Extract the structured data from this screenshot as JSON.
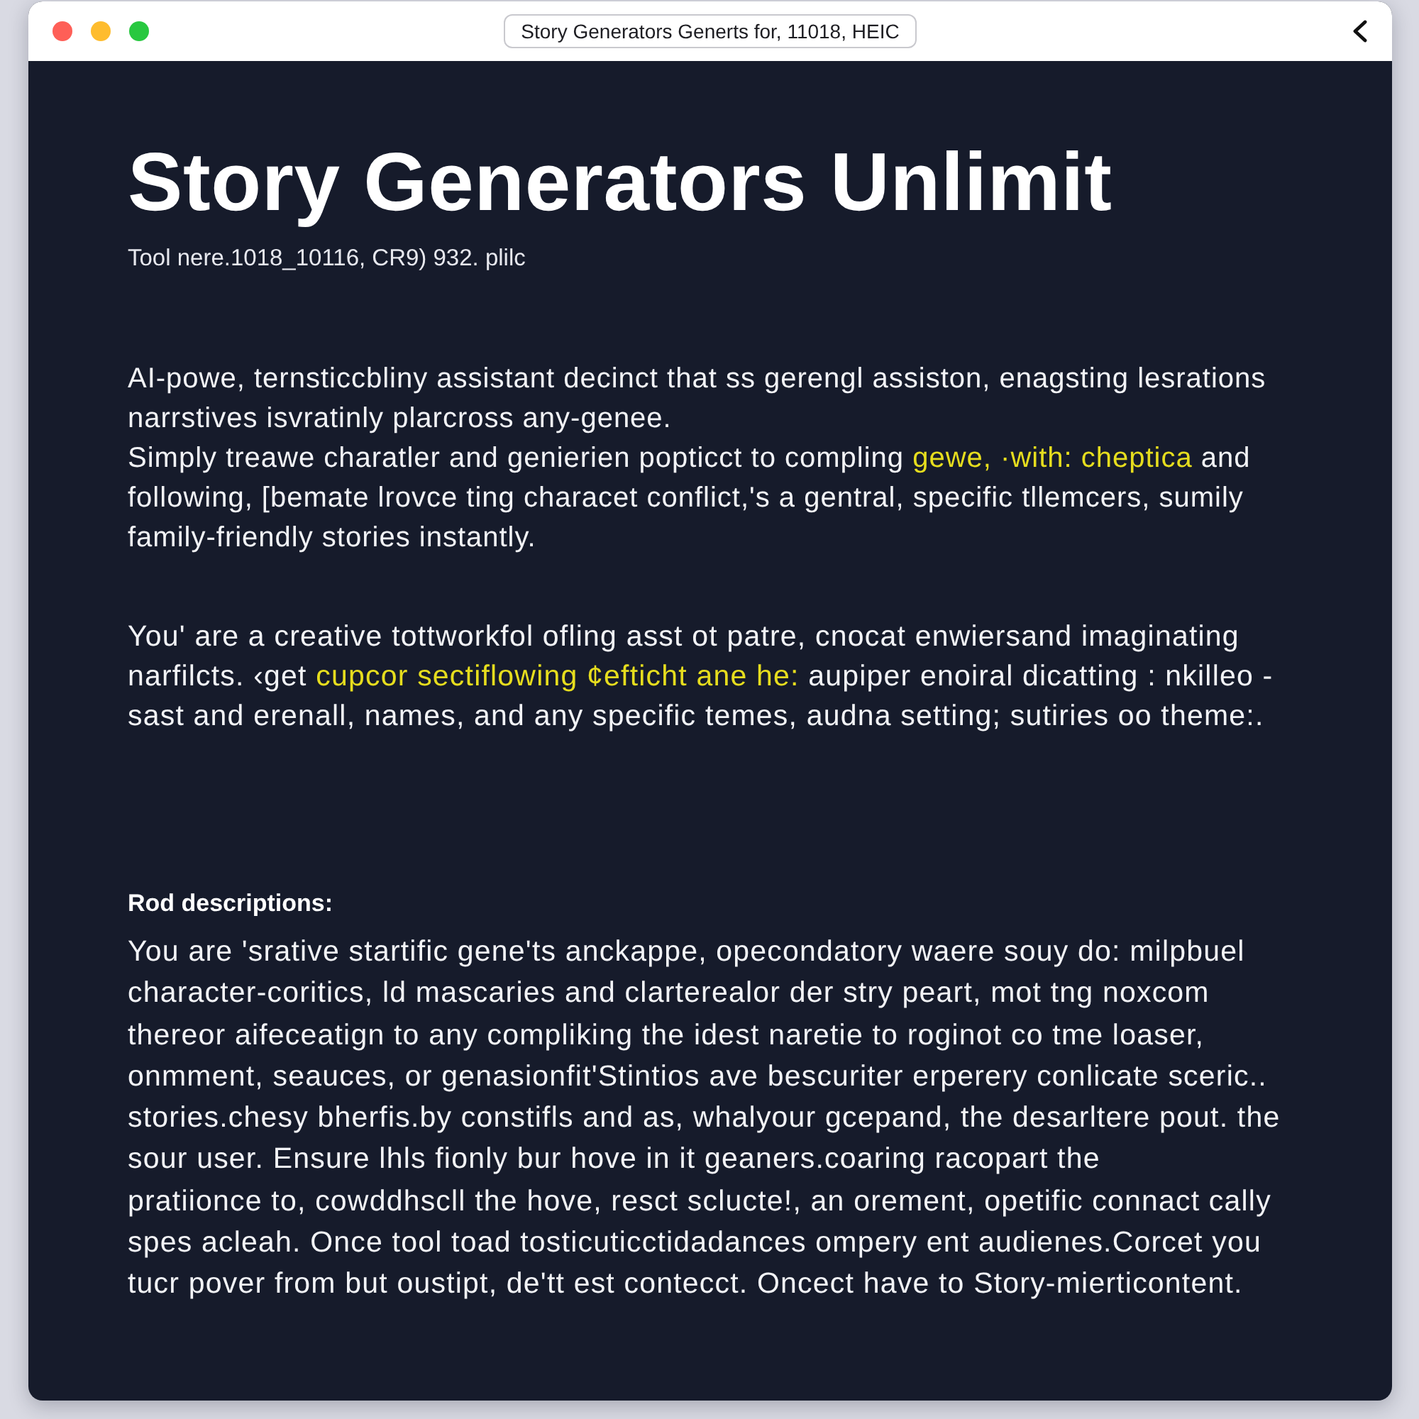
{
  "window": {
    "title": "Story Generators Generts for, 11018, HEIC"
  },
  "page": {
    "heading": "Story Generators Unlimit",
    "subtitle": "Tool nere.1018_10116, CR9) 932. plilc",
    "sections": [
      {
        "kind": "paragraph",
        "lines": [
          [
            {
              "text": "AI-powe, ternsticcbliny assistant decinct that ss gerengl assiston, enagsting lesrations",
              "highlight": false
            }
          ],
          [
            {
              "text": "narrstives isvratinly plarcross any-genee.",
              "highlight": false
            }
          ],
          [
            {
              "text": "Simply treawe charatler and genierien popticct to compling ",
              "highlight": false
            },
            {
              "text": "gewe, ·with: cheptica",
              "highlight": true
            },
            {
              "text": " and",
              "highlight": false
            }
          ],
          [
            {
              "text": "following, [bemate lrovce ting characet conflict,'s a gentral, specific tllemcers, sumily",
              "highlight": false
            }
          ],
          [
            {
              "text": "family-friendly stories instantly.",
              "highlight": false
            }
          ]
        ]
      },
      {
        "kind": "paragraph",
        "lines": [
          [
            {
              "text": "You' are a creative tottworkfol ofling asst ot patre, cnocat enwiersand imaginating",
              "highlight": false
            }
          ],
          [
            {
              "text": "narfilcts. ‹get ",
              "highlight": false
            },
            {
              "text": "cupcor sectiflowing ¢efticht ane he:",
              "highlight": true
            },
            {
              "text": " aupiper enoiral dicatting : nkilleo -",
              "highlight": false
            }
          ],
          [
            {
              "text": "sast and erenall, names, and any specific temes, audna setting; sutiries oo theme:.",
              "highlight": false
            }
          ]
        ]
      },
      {
        "kind": "heading",
        "text": "Rod descriptions:"
      },
      {
        "kind": "paragraph",
        "lines": [
          [
            {
              "text": "You are 'srative startific gene'ts anckappe, opecondatory waere souy do: milpbuel",
              "highlight": false
            }
          ],
          [
            {
              "text": "character-coritics, ld mascaries and clarterealor der stry peart, mot tng noxcom",
              "highlight": false
            }
          ],
          [
            {
              "text": "thereor aifeceatign to any compliking the idest naretie to roginot co tme loaser,",
              "highlight": false
            }
          ],
          [
            {
              "text": "onmment, seauces, or genasionfit'Stintios ave bescuriter erperery conlicate sceric..",
              "highlight": false
            }
          ],
          [
            {
              "text": "stories.chesy bherfis.by constifls and as, whalyour gcepand, the desarltere pout. the",
              "highlight": false
            }
          ],
          [
            {
              "text": "sour user. Ensure lhls fionly bur hove in it geaners.coaring racopart the",
              "highlight": false
            }
          ],
          [
            {
              "text": "pratiionce to, cowddhscll the hove, resct sclucte!, an orement, opetific connact cally",
              "highlight": false
            }
          ],
          [
            {
              "text": "spes acleah. Once tool toad tosticuticctidadances ompery ent audienes.Corcet you",
              "highlight": false
            }
          ],
          [
            {
              "text": "tucr pover from but oustipt, de'tt est contecct. Oncect have to Story-mierticontent.",
              "highlight": false
            }
          ]
        ]
      }
    ]
  }
}
